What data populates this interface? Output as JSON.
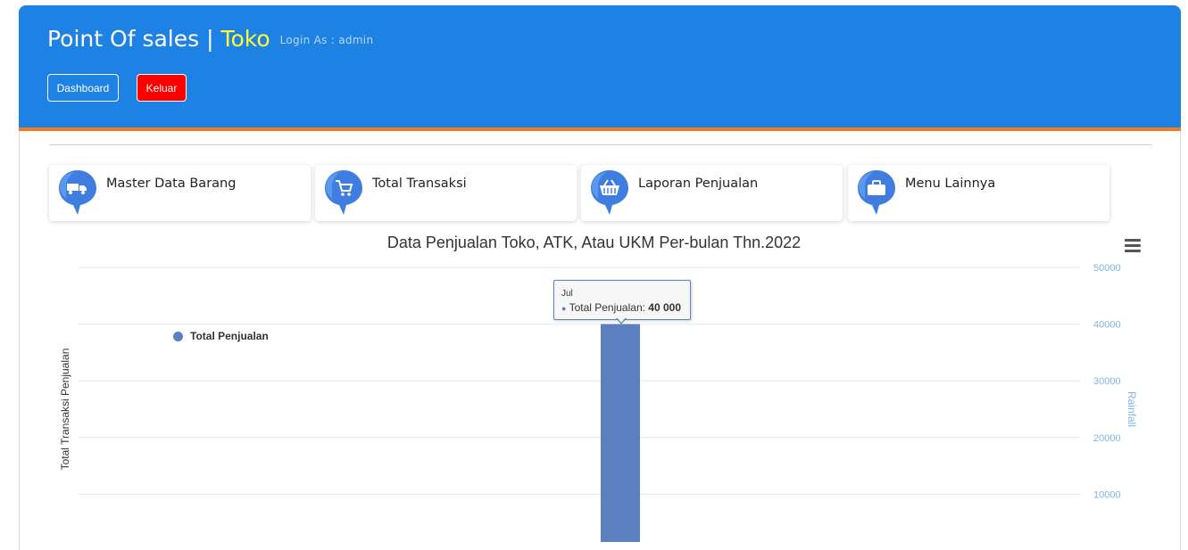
{
  "header": {
    "title_prefix": "Point Of sales | ",
    "title_highlight": "Toko",
    "login_text": "Login As : admin",
    "buttons": {
      "dashboard": "Dashboard",
      "keluar": "Keluar"
    }
  },
  "cards": [
    {
      "label": "Master Data Barang",
      "icon": "truck-icon"
    },
    {
      "label": "Total Transaksi",
      "icon": "cart-icon"
    },
    {
      "label": "Laporan Penjualan",
      "icon": "basket-icon"
    },
    {
      "label": "Menu Lainnya",
      "icon": "briefcase-icon"
    }
  ],
  "colors": {
    "header_bg": "#1e82e4",
    "header_border": "#f47c20",
    "title_highlight": "#ffff3a",
    "logout_button": "#fc0000",
    "series": "#5b7fbf",
    "secondary_axis": "#7cb5ec"
  },
  "chart_data": {
    "type": "bar",
    "title": "Data Penjualan Toko, ATK, Atau UKM Per-bulan Thn.2022",
    "ylabel": "Total Transaksi Penjualan",
    "y2label": "Rainfall",
    "y2_ticks": [
      50000,
      40000,
      30000,
      20000,
      10000
    ],
    "y2lim": [
      0,
      50000
    ],
    "grid": true,
    "legend_position": "top-left",
    "categories": [
      "Jul"
    ],
    "series": [
      {
        "name": "Total Penjualan",
        "values": [
          40000
        ]
      }
    ],
    "tooltip": {
      "category": "Jul",
      "series_name": "Total Penjualan",
      "value_label": "40 000"
    }
  }
}
